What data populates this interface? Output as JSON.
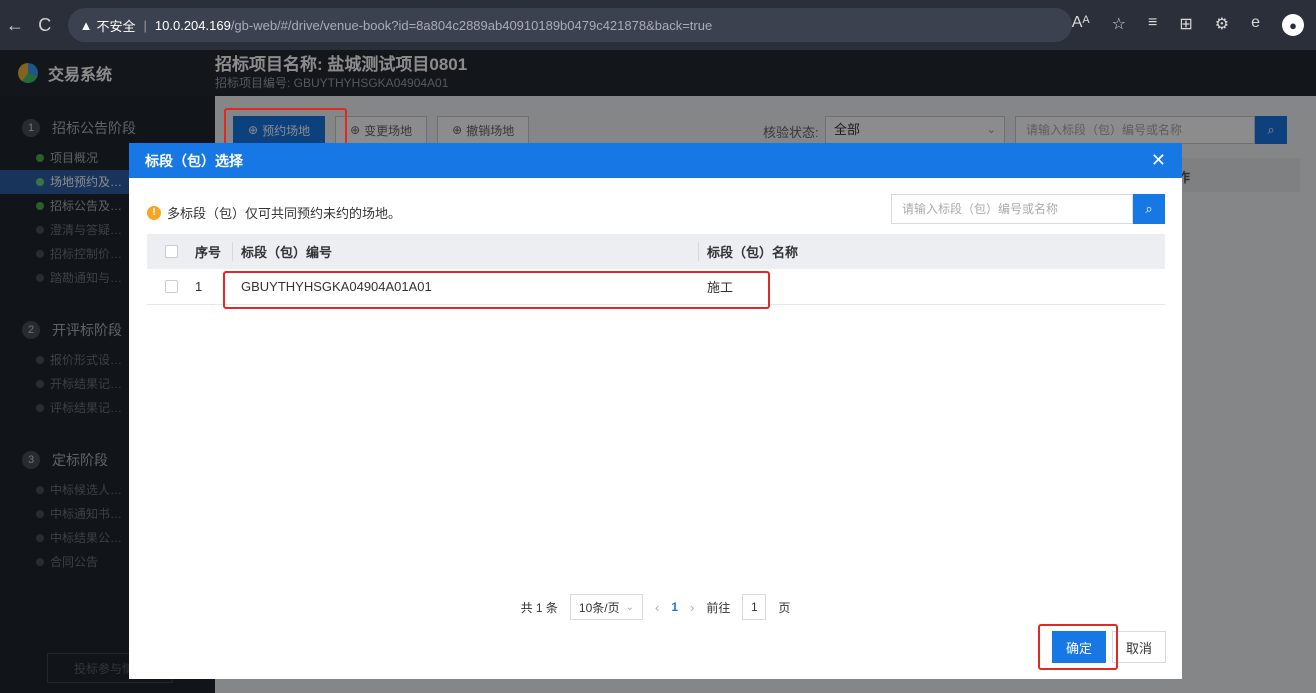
{
  "browser": {
    "back": "←",
    "reload": "C",
    "security_label": "不安全",
    "url_host": "10.0.204.169",
    "url_path": "/gb-web/#/drive/venue-book?id=8a804c2889ab40910189b0479c421878&back=true"
  },
  "app": {
    "name": "交易系统",
    "project_title": "招标项目名称: 盐城测试项目0801",
    "project_code": "招标项目编号: GBUYTHYHSGKA04904A01"
  },
  "sidebar": {
    "stages": [
      {
        "num": "1",
        "label": "招标公告阶段",
        "items": [
          {
            "label": "项目概况",
            "state": "done"
          },
          {
            "label": "场地预约及…",
            "state": "active"
          },
          {
            "label": "招标公告及…",
            "state": "done"
          },
          {
            "label": "澄清与答疑…",
            "state": "pending"
          },
          {
            "label": "招标控制价…",
            "state": "pending"
          },
          {
            "label": "踏勘通知与…",
            "state": "pending"
          }
        ]
      },
      {
        "num": "2",
        "label": "开评标阶段",
        "items": [
          {
            "label": "报价形式设…",
            "state": "pending"
          },
          {
            "label": "开标结果记…",
            "state": "pending"
          },
          {
            "label": "评标结果记…",
            "state": "pending"
          }
        ]
      },
      {
        "num": "3",
        "label": "定标阶段",
        "items": [
          {
            "label": "中标候选人…",
            "state": "pending"
          },
          {
            "label": "中标通知书…",
            "state": "pending"
          },
          {
            "label": "中标结果公…",
            "state": "pending"
          },
          {
            "label": "合同公告",
            "state": "pending"
          }
        ]
      }
    ],
    "bottom_button": "投标参与情况"
  },
  "main": {
    "btn_book": "预约场地",
    "btn_change": "变更场地",
    "btn_cancel": "撤销场地",
    "filter_label": "核验状态:",
    "filter_value": "全部",
    "search_placeholder": "请输入标段（包）编号或名称",
    "col_operation": "操作"
  },
  "dialog": {
    "title": "标段（包）选择",
    "notice": "多标段（包）仅可共同预约未约的场地。",
    "search_placeholder": "请输入标段（包）编号或名称",
    "columns": {
      "index": "序号",
      "code": "标段（包）编号",
      "name": "标段（包）名称"
    },
    "rows": [
      {
        "index": "1",
        "code": "GBUYTHYHSGKA04904A01A01",
        "name": "施工"
      }
    ],
    "pager": {
      "total": "共 1 条",
      "page_size": "10条/页",
      "current": "1",
      "goto_prefix": "前往",
      "goto_value": "1",
      "goto_suffix": "页"
    },
    "confirm": "确定",
    "cancel": "取消"
  },
  "colors": {
    "primary": "#1677e5",
    "annotation": "#e32626",
    "warning": "#f5a623"
  }
}
